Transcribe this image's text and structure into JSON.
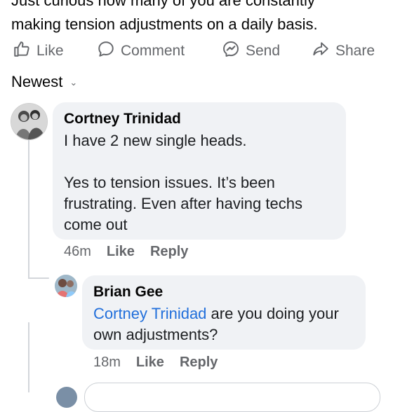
{
  "post": {
    "text_line1": "Just curious how many of you are constantly",
    "text_line2": "making tension adjustments on a daily basis."
  },
  "actions": {
    "like": "Like",
    "comment": "Comment",
    "send": "Send",
    "share": "Share"
  },
  "sort": {
    "label": "Newest"
  },
  "comments": [
    {
      "author": "Cortney Trinidad",
      "line1": "I have 2 new single heads.",
      "line2": "Yes to tension issues. It’s been",
      "line3": "frustrating. Even after having techs",
      "line4": "come out",
      "time": "46m",
      "like": "Like",
      "reply": "Reply"
    }
  ],
  "replies": [
    {
      "author": "Brian Gee",
      "mention": "Cortney Trinidad",
      "text1": " are you doing your",
      "text2": "own adjustments?",
      "time": "18m",
      "like": "Like",
      "reply": "Reply"
    }
  ],
  "colors": {
    "mention": "#216fdb",
    "bubble": "#f0f2f5",
    "meta": "#65676b"
  },
  "icons": [
    "thumbs-up-icon",
    "comment-icon",
    "messenger-icon",
    "share-icon",
    "chevron-down-icon"
  ]
}
